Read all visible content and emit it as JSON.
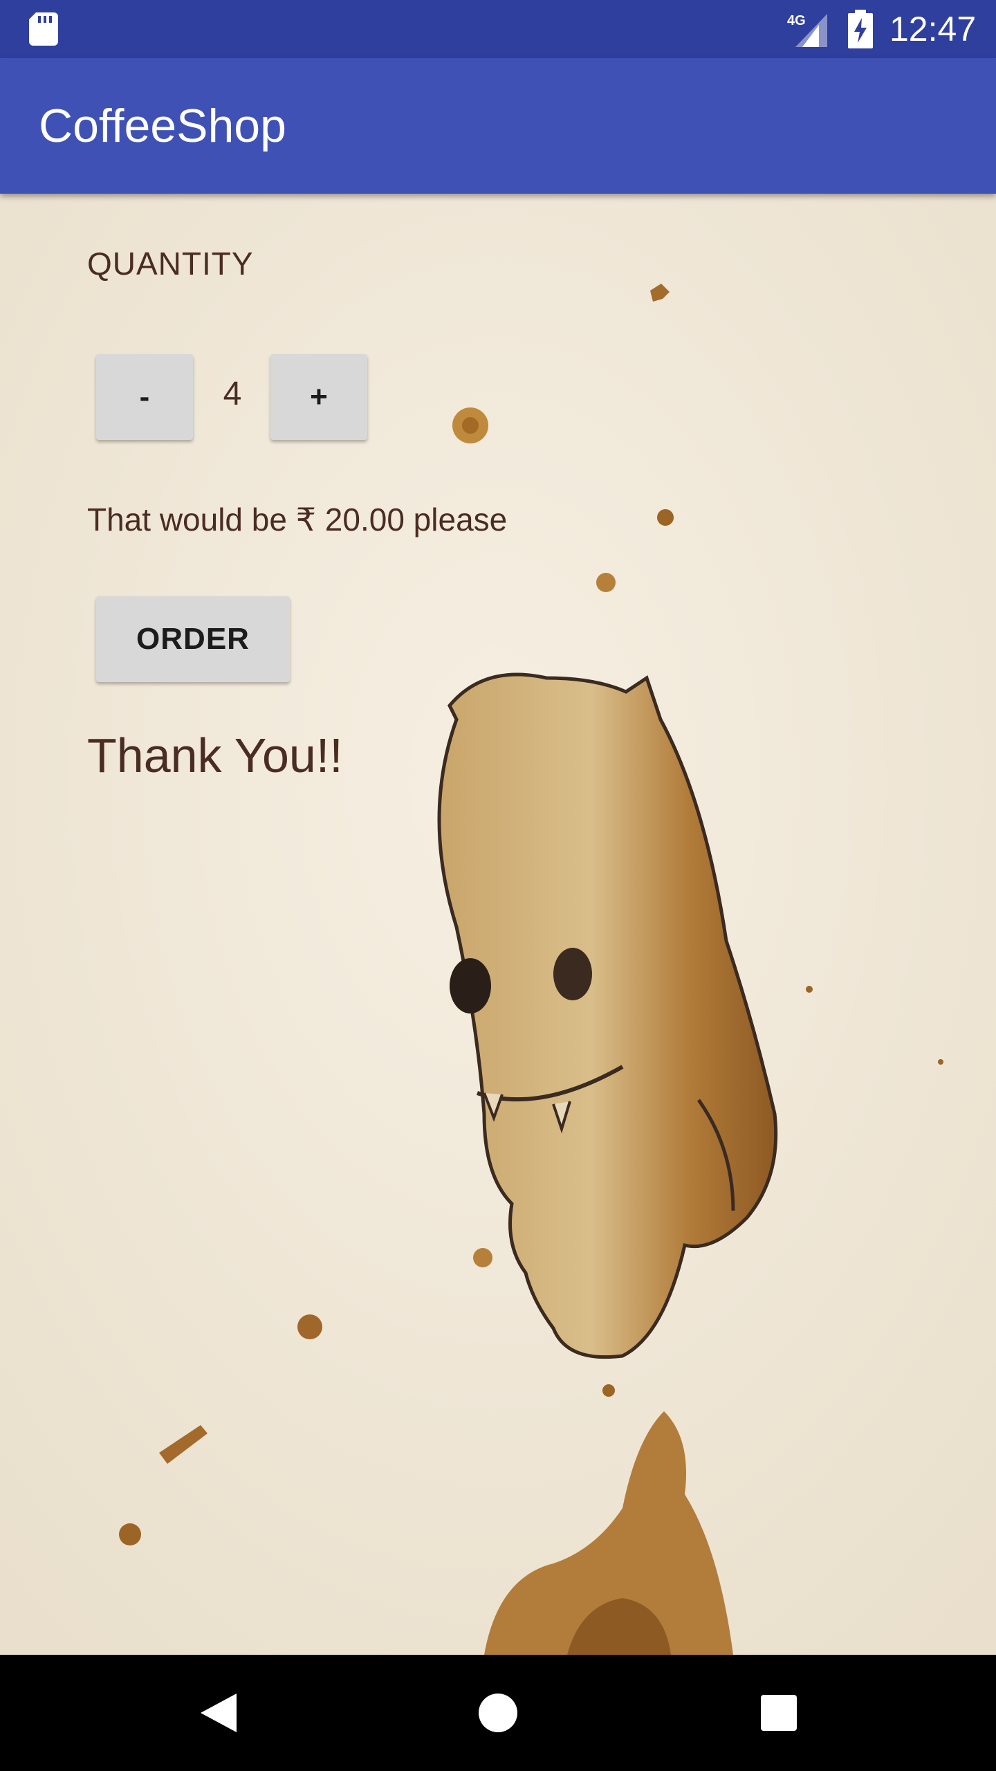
{
  "status_bar": {
    "time": "12:47",
    "network": "4G",
    "icons": [
      "sd-card-icon",
      "signal-icon",
      "battery-charging-icon"
    ]
  },
  "app_bar": {
    "title": "CoffeeShop",
    "color": "#3f51b5"
  },
  "order_form": {
    "quantity_label": "QUANTITY",
    "decrement_label": "-",
    "quantity": "4",
    "increment_label": "+",
    "price_message": "That would be ₹ 20.00 please",
    "order_label": "ORDER",
    "thank_you": "Thank You!!"
  },
  "nav_bar": {
    "icons": [
      "back-icon",
      "home-icon",
      "recents-icon"
    ]
  },
  "colors": {
    "status_bar": "#2f3f9e",
    "text": "#4a2c23",
    "button": "#d8d8d8",
    "background": "#f1e8d8"
  }
}
